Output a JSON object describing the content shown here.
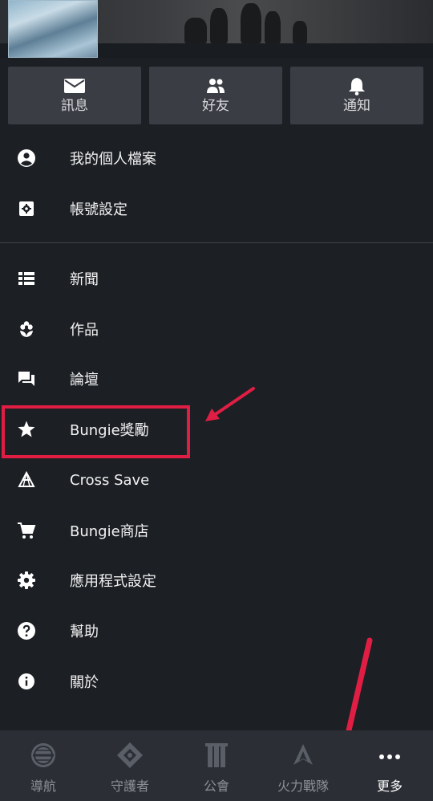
{
  "profile_actions": [
    {
      "label": "訊息",
      "icon": "mail-icon"
    },
    {
      "label": "好友",
      "icon": "friends-icon"
    },
    {
      "label": "通知",
      "icon": "bell-icon"
    }
  ],
  "menu_account": [
    {
      "label": "我的個人檔案",
      "icon": "account-circle-icon"
    },
    {
      "label": "帳號設定",
      "icon": "account-settings-icon"
    }
  ],
  "menu_main": [
    {
      "label": "新聞",
      "icon": "list-icon"
    },
    {
      "label": "作品",
      "icon": "flower-icon"
    },
    {
      "label": "論壇",
      "icon": "forum-icon"
    },
    {
      "label": "Bungie獎勵",
      "icon": "star-icon"
    },
    {
      "label": "Cross Save",
      "icon": "cross-save-icon"
    },
    {
      "label": "Bungie商店",
      "icon": "cart-icon"
    },
    {
      "label": "應用程式設定",
      "icon": "gear-icon"
    },
    {
      "label": "幫助",
      "icon": "help-icon"
    },
    {
      "label": "關於",
      "icon": "info-icon"
    }
  ],
  "bottom_nav": [
    {
      "label": "導航",
      "icon": "globe-icon",
      "active": false
    },
    {
      "label": "守護者",
      "icon": "ghost-icon",
      "active": false
    },
    {
      "label": "公會",
      "icon": "clan-banner-icon",
      "active": false
    },
    {
      "label": "火力戰隊",
      "icon": "fireteam-icon",
      "active": false
    },
    {
      "label": "更多",
      "icon": "more-dots-icon",
      "active": true
    }
  ],
  "colors": {
    "background": "#1c1f24",
    "button_bg": "#3a3d44",
    "nav_bg": "#2b2e35",
    "annotation": "#e01e44",
    "inactive_text": "#8d9097"
  }
}
